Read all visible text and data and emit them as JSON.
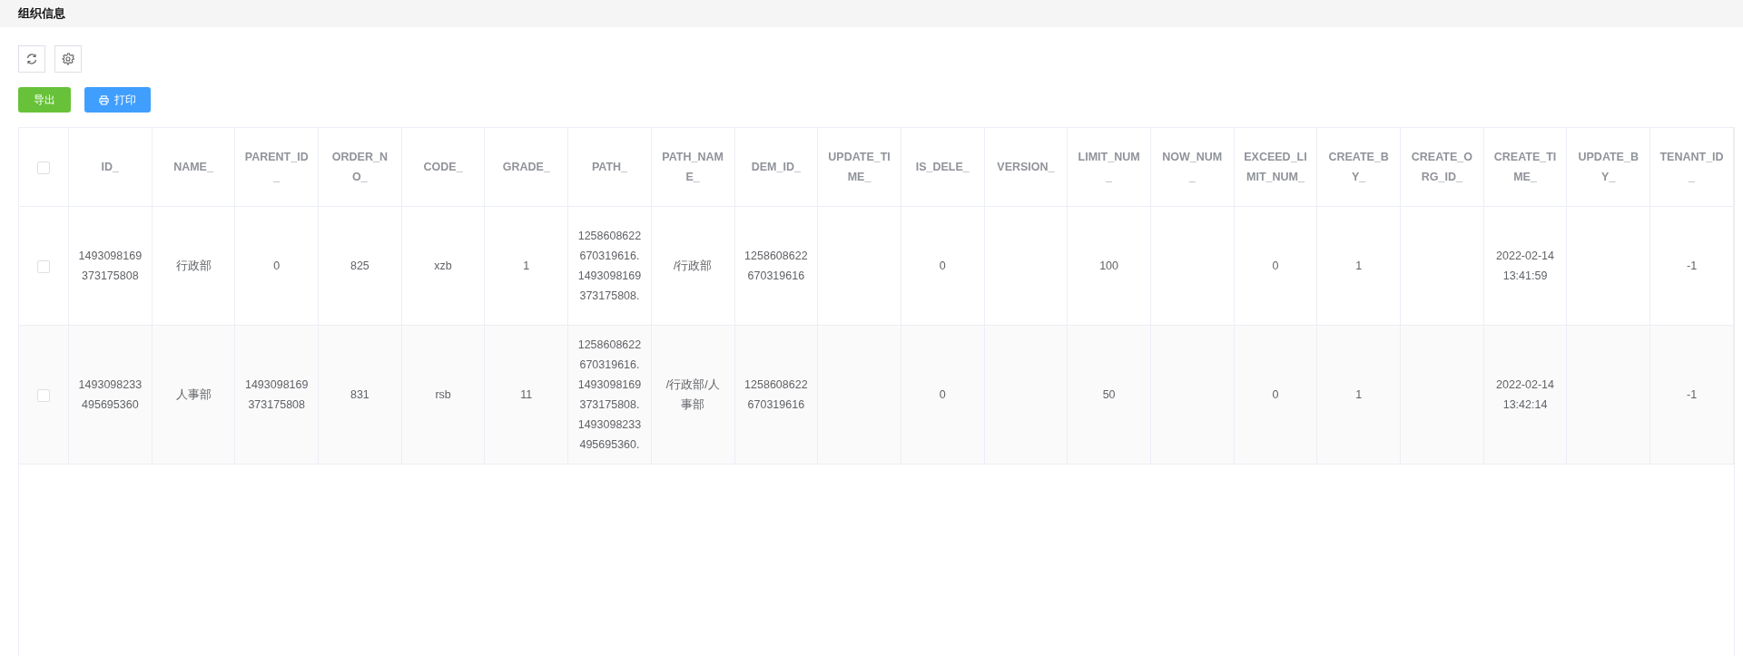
{
  "header": {
    "title": "组织信息"
  },
  "toolbar": {
    "icon_buttons": [
      {
        "kind": "refresh"
      },
      {
        "kind": "settings"
      }
    ],
    "actions": [
      {
        "kind": "export",
        "label": "导出"
      },
      {
        "kind": "print",
        "label": "打印"
      }
    ]
  },
  "table": {
    "select_all_checked": false,
    "columns": [
      "ID_",
      "NAME_",
      "PARENT_ID_",
      "ORDER_NO_",
      "CODE_",
      "GRADE_",
      "PATH_",
      "PATH_NAME_",
      "DEM_ID_",
      "UPDATE_TIME_",
      "IS_DELE_",
      "VERSION_",
      "LIMIT_NUM_",
      "NOW_NUM_",
      "EXCEED_LIMIT_NUM_",
      "CREATE_BY_",
      "CREATE_ORG_ID_",
      "CREATE_TIME_",
      "UPDATE_BY_",
      "TENANT_ID_"
    ],
    "rows": [
      {
        "checked": false,
        "cells": [
          "1493098169373175808",
          "行政部",
          "0",
          "825",
          "xzb",
          "1",
          "1258608622670319616.1493098169373175808.",
          "/行政部",
          "1258608622670319616",
          null,
          "0",
          null,
          "100",
          null,
          "0",
          "1",
          null,
          "2022-02-14 13:41:59",
          null,
          "-1"
        ]
      },
      {
        "checked": false,
        "cells": [
          "1493098233495695360",
          "人事部",
          "1493098169373175808",
          "831",
          "rsb",
          "11",
          "1258608622670319616.1493098169373175808.1493098233495695360.",
          "/行政部/人事部",
          "1258608622670319616",
          null,
          "0",
          null,
          "50",
          null,
          "0",
          "1",
          null,
          "2022-02-14 13:42:14",
          null,
          "-1"
        ]
      }
    ]
  }
}
